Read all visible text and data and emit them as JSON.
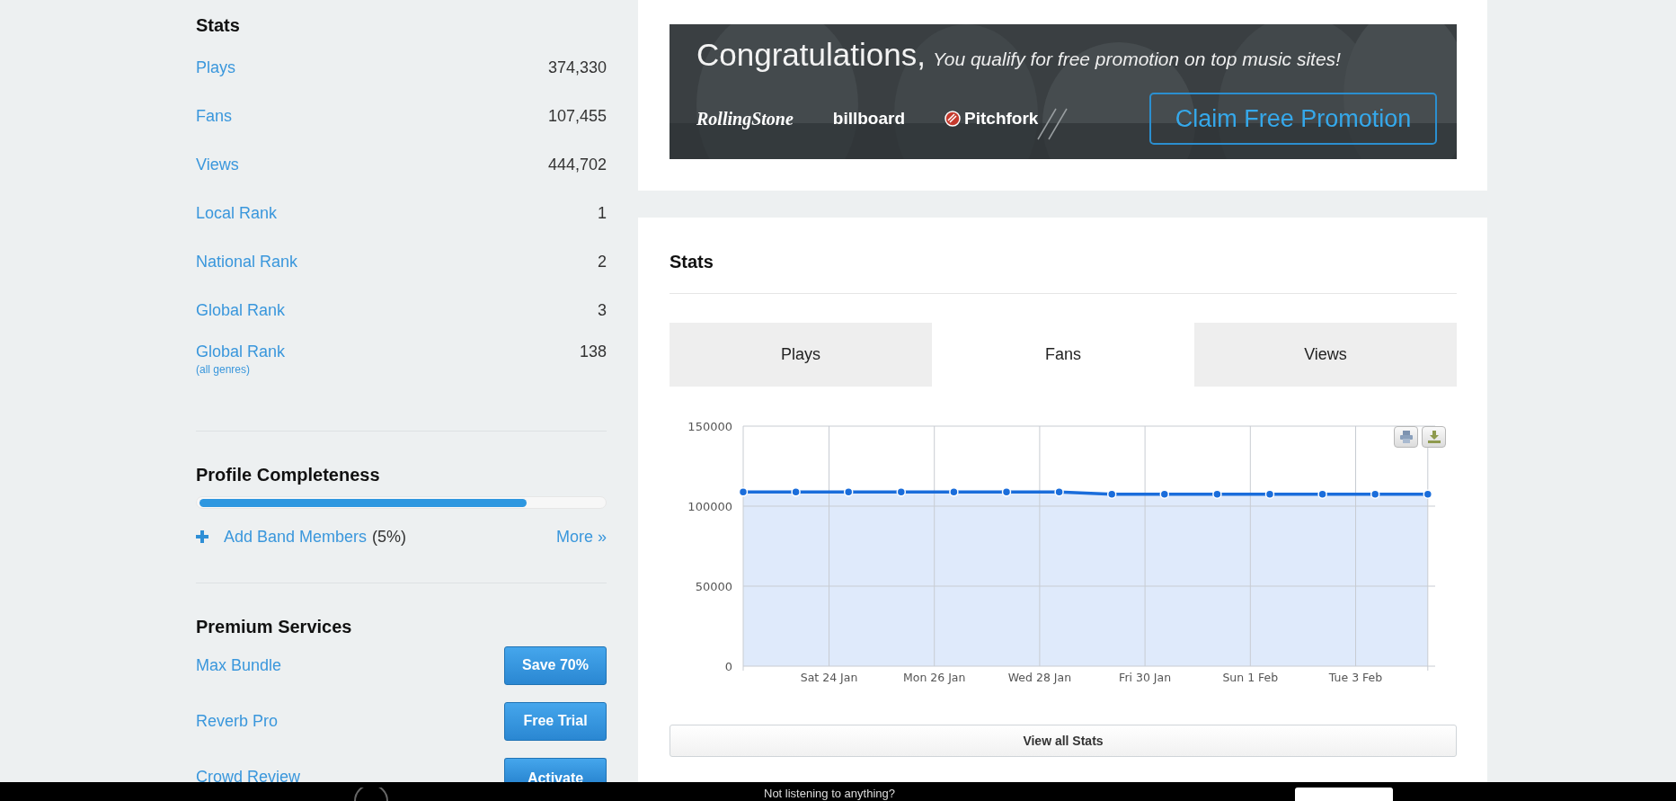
{
  "sidebar": {
    "stats": {
      "title": "Stats",
      "rows": [
        {
          "label": "Plays",
          "value": "374,330"
        },
        {
          "label": "Fans",
          "value": "107,455"
        },
        {
          "label": "Views",
          "value": "444,702"
        },
        {
          "label": "Local Rank",
          "value": "1"
        },
        {
          "label": "National Rank",
          "value": "2"
        },
        {
          "label": "Global Rank",
          "value": "3"
        },
        {
          "label": "Global Rank",
          "value": "138",
          "note": "(all genres)"
        }
      ]
    },
    "profile": {
      "title": "Profile Completeness",
      "level": 0.81,
      "action": "Add Band Members",
      "percent": "(5%)",
      "more": "More »"
    },
    "premium": {
      "title": "Premium Services",
      "items": [
        {
          "name": "Max Bundle",
          "button": "Save 70%"
        },
        {
          "name": "Reverb Pro",
          "button": "Free Trial"
        },
        {
          "name": "Crowd Review",
          "button": "Activate"
        }
      ]
    }
  },
  "banner": {
    "headline": "Congratulations,",
    "subline": "You qualify for free promotion on top music sites!",
    "logos": [
      "RollingStone",
      "billboard",
      "Pitchfork"
    ],
    "button": "Claim Free Promotion"
  },
  "stats_panel": {
    "title": "Stats",
    "tabs": [
      {
        "label": "Plays",
        "selected": false
      },
      {
        "label": "Fans",
        "selected": true
      },
      {
        "label": "Views",
        "selected": false
      }
    ],
    "chart_data": {
      "type": "area",
      "categories": [
        null,
        null,
        "Sat 24 Jan",
        null,
        "Mon 26 Jan",
        null,
        "Wed 28 Jan",
        null,
        "Fri 30 Jan",
        null,
        "Sun 1 Feb",
        null,
        "Tue 3 Feb",
        null
      ],
      "ylim": [
        0,
        150000
      ],
      "yticks": [
        0,
        50000,
        100000,
        150000
      ],
      "grid": true,
      "series": [
        {
          "color": "#1a6ddb",
          "values": [
            108800,
            108800,
            108800,
            108800,
            108800,
            108800,
            108800,
            107500,
            107500,
            107500,
            107500,
            107500,
            107500,
            107500
          ]
        }
      ]
    },
    "button": "View all Stats"
  },
  "player_bar": {
    "message": "Not listening to anything?"
  }
}
